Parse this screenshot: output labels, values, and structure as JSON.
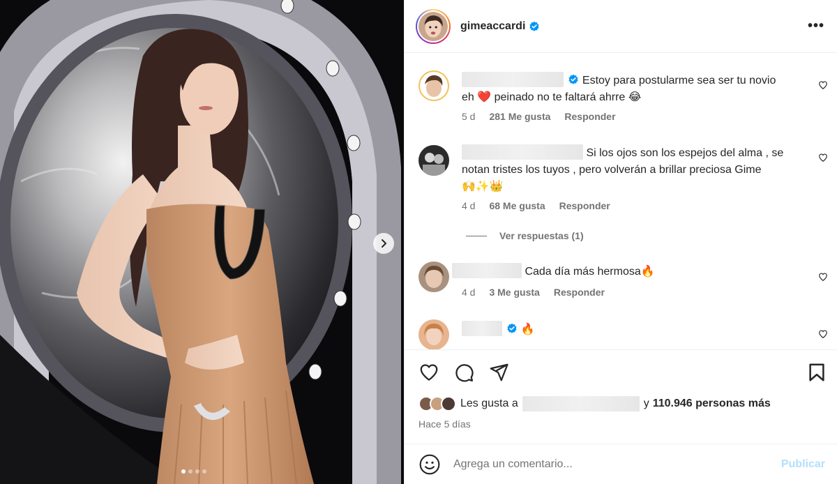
{
  "post": {
    "username": "gimeaccardi",
    "more_icon": "more-horizontal-icon"
  },
  "carousel": {
    "slide_count": 4,
    "active_slide": 1
  },
  "comments": [
    {
      "text": "Estoy para postularme sea ser tu novio eh ❤️ peinado no te faltará ahrre 😂",
      "line1": "Estoy para postularme sea ser tu novio",
      "line2": "eh ❤️ peinado no te faltará ahrre 😂",
      "time": "5 d",
      "likes": "281 Me gusta",
      "reply": "Responder",
      "verified": true
    },
    {
      "line1": "Si los ojos son los espejos del alma , se",
      "line2": "notan tristes los tuyos , pero volverán a brillar preciosa Gime",
      "line3": "🙌✨👑",
      "time": "4 d",
      "likes": "68 Me gusta",
      "reply": "Responder",
      "view_replies": "Ver respuestas (1)"
    },
    {
      "line1": "Cada día más hermosa🔥",
      "time": "4 d",
      "likes": "3 Me gusta",
      "reply": "Responder"
    },
    {
      "line1": "🔥",
      "verified": true
    }
  ],
  "likes_summary": {
    "prefix": "Les gusta a",
    "connector": "y",
    "count_text": "110.946 personas más"
  },
  "time_ago": "Hace 5 días",
  "composer": {
    "placeholder": "Agrega un comentario...",
    "publish_label": "Publicar"
  },
  "colors": {
    "verified_blue": "#0095f6",
    "text": "#262626",
    "muted": "#737373",
    "publish_disabled": "#b2dffc"
  }
}
